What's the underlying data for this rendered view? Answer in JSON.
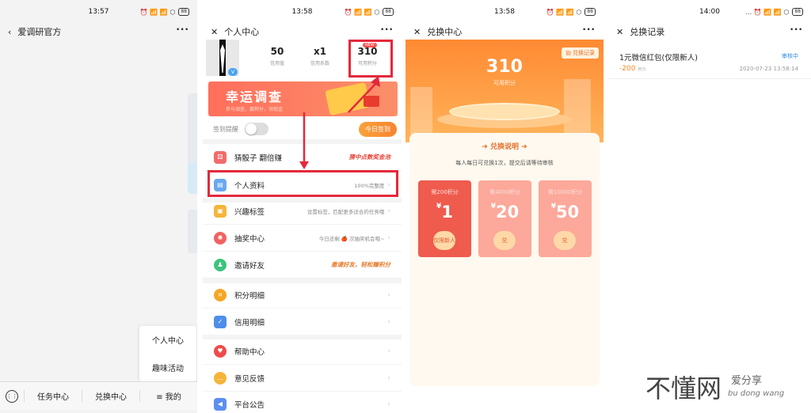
{
  "panel1": {
    "time": "13:57",
    "status_icons": "⏰ 📶 📶 ⬡",
    "battery": "88",
    "title": "爱调研官方",
    "more": "···",
    "popup": [
      "个人中心",
      "趣味活动"
    ],
    "tabs": [
      "任务中心",
      "兑换中心",
      "≡ 我的"
    ]
  },
  "panel2": {
    "time": "13:58",
    "status_icons": "⏰ 📶 📶 ⬡",
    "battery": "88",
    "title": "个人中心",
    "more": "···",
    "stats": [
      {
        "value": "50",
        "label": "信用值"
      },
      {
        "value": "x1",
        "label": "信用系数"
      },
      {
        "value": "310",
        "label": "可用积分"
      }
    ],
    "new_tag": "NEW",
    "v_badge": "V",
    "banner_title": "幸运调查",
    "banner_sub": "参与调查，赢积分，领现金",
    "sign_label": "签到提醒",
    "sign_button": "今日签到",
    "menu": [
      {
        "label": "猜骰子 翻倍赚",
        "right": "猜中点数奖金池",
        "highlight": true
      },
      {
        "label": "个人资料",
        "right": "100%完整度",
        "highlight": false
      },
      {
        "label": "兴趣标签",
        "right": "设置标签，匹配更多适合的任务哦",
        "highlight": false
      },
      {
        "label": "抽奖中心",
        "right": "今日还剩 🍎 次抽奖机会哦~",
        "highlight": false
      },
      {
        "label": "邀请好友",
        "right": "邀请好友，轻松赚积分",
        "highlight": true
      },
      {
        "label": "积分明细",
        "right": "",
        "highlight": false
      },
      {
        "label": "信用明细",
        "right": "",
        "highlight": false
      },
      {
        "label": "帮助中心",
        "right": "",
        "highlight": false
      },
      {
        "label": "意见反馈",
        "right": "",
        "highlight": false
      },
      {
        "label": "平台公告",
        "right": "",
        "highlight": false
      }
    ]
  },
  "panel3": {
    "time": "13:58",
    "status_icons": "⏰ 📶 📶 ⬡",
    "battery": "88",
    "title": "兑换中心",
    "more": "···",
    "points": "310",
    "points_label": "可用积分",
    "history": "兑换记录",
    "section_title": "兑换说明",
    "desc": "每人每日可兑换1次，提交后请等待审核",
    "tiles": [
      {
        "label": "需200积分",
        "amount": "1",
        "button": "仅限新人"
      },
      {
        "label": "需4000积分",
        "amount": "20",
        "button": "兑"
      },
      {
        "label": "需10000积分",
        "amount": "50",
        "button": "兑"
      }
    ],
    "currency": "¥"
  },
  "panel4": {
    "time": "14:00",
    "status_icons": "… ⏰ 📶 📶 ⬡",
    "battery": "88",
    "title": "兑换记录",
    "more": "···",
    "record": {
      "title": "1元微信红包(仅限新人)",
      "status": "审核中",
      "amount": "-200",
      "unit": "积分",
      "date": "2020-07-23 13:58:14"
    }
  },
  "watermark": {
    "big": "不懂网",
    "small1": "爱分享",
    "small2": "bu dong wang"
  },
  "colors": {
    "accent_red": "#e4283b",
    "orange": "#f7842f",
    "blue": "#2e8ae6"
  }
}
